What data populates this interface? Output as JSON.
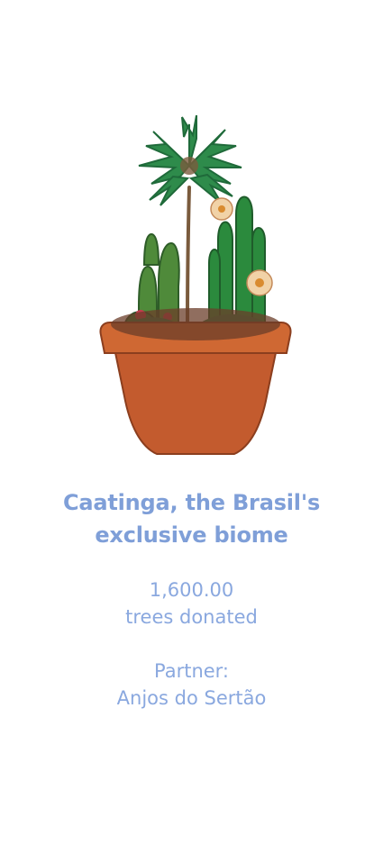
{
  "project": {
    "title_line_1": "Caatinga, the Brasil's",
    "title_line_2": "exclusive biome",
    "trees_count": "1,600.00",
    "trees_label": "trees donated",
    "partner_label": "Partner:",
    "partner_name": "Anjos do Sertão"
  },
  "colors": {
    "text_primary": "#7f9fd8",
    "text_secondary": "#8aa8df",
    "pot": "#c35b2e",
    "plant_green": "#2f8a4a"
  }
}
